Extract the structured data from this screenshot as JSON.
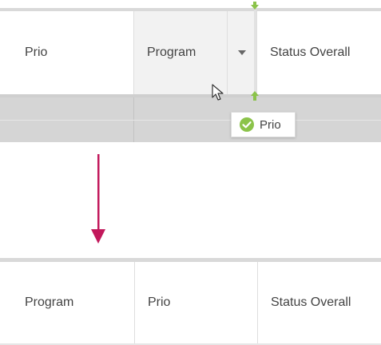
{
  "before": {
    "headers": {
      "prio": "Prio",
      "program": "Program",
      "status_overall": "Status Overall"
    },
    "drag_ghost": {
      "label": "Prio",
      "icon": "check-circle-icon"
    },
    "menu_icon": "chevron-down-icon"
  },
  "after": {
    "headers": {
      "program": "Program",
      "prio": "Prio",
      "status_overall": "Status Overall"
    }
  },
  "colors": {
    "drop_indicator": "#8bc34a",
    "arrow": "#c2185b",
    "check_icon": "#8bc34a",
    "selected_row": "#d5d5d5"
  }
}
